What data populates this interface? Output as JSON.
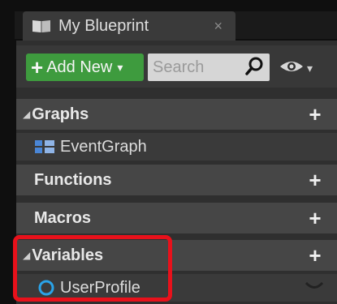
{
  "tab": {
    "title": "My Blueprint",
    "close": "×",
    "icon": "book-icon"
  },
  "toolbar": {
    "add_new": {
      "plus": "+",
      "label": "Add New",
      "caret": "▾"
    },
    "search": {
      "placeholder": "Search",
      "icon": "search-icon"
    },
    "view_options": {
      "icon": "eye-icon",
      "caret": "▾"
    }
  },
  "sections": {
    "graphs": {
      "arrow": "◢",
      "label": "Graphs",
      "add": "+"
    },
    "functions": {
      "label": "Functions",
      "add": "+"
    },
    "macros": {
      "label": "Macros",
      "add": "+"
    },
    "variables": {
      "arrow": "◢",
      "label": "Variables",
      "add": "+"
    }
  },
  "items": {
    "event_graph": {
      "label": "EventGraph",
      "icon": "graph-icon"
    },
    "user_profile": {
      "label": "UserProfile",
      "icon": "variable-pin-icon"
    }
  },
  "colors": {
    "add_new_bg": "#3e9b3e",
    "highlight": "#e8111b",
    "variable_pin": "#2aa3e8"
  }
}
